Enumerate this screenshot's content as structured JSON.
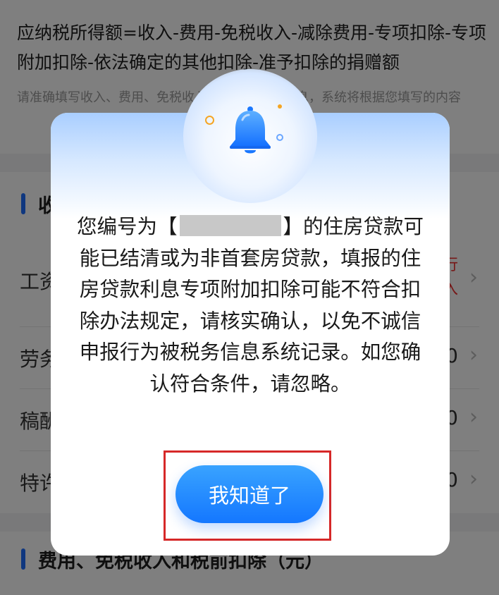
{
  "background": {
    "formula": "应纳税所得额=收入-费用-免税收入-减除费用-专项扣除-专项附加扣除-依法确定的其他扣除-准予扣除的捐赠额",
    "hint": "请准确填写收入、费用、免税收入和税前扣除等信息，系统将根据您填写的内容",
    "section1_title": "收入",
    "rows": [
      {
        "label": "工资",
        "value": "",
        "note_line1": "行",
        "note_line2": "入"
      },
      {
        "label": "劳务",
        "value": "0"
      },
      {
        "label": "稿酬",
        "value": "0"
      },
      {
        "label": "特许",
        "value": "0"
      }
    ],
    "section2_title": "费用、免税收入和税前扣除（元）"
  },
  "modal": {
    "message_prefix": "您编号为【",
    "message_suffix": "】的住房贷款可能已结清或为非首套房贷款，填报的住房贷款利息专项附加扣除可能不符合扣除办法规定，请核实确认，以免不诚信申报行为被税务信息系统记录。如您确认符合条件，请忽略。",
    "icon": "bell-icon",
    "button_label": "我知道了",
    "accent_color": "#1477ff",
    "highlight_color": "#d62828"
  }
}
